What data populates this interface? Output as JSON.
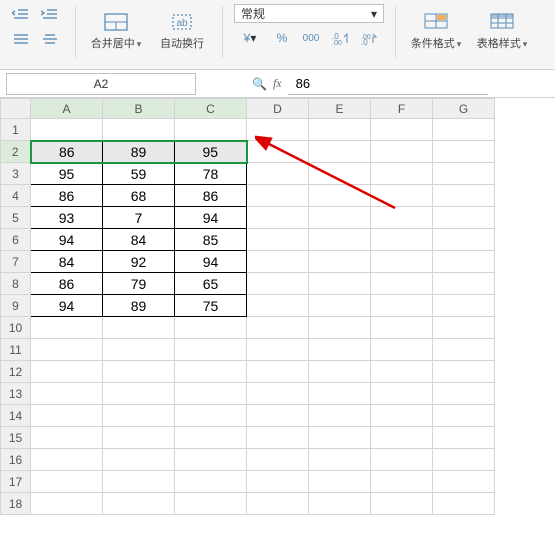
{
  "ribbon": {
    "merge_center": "合并居中",
    "wrap_text": "自动换行",
    "number_format": "常规",
    "conditional_format": "条件格式",
    "table_style": "表格样式"
  },
  "namebox": "A2",
  "formula_value": "86",
  "columns": [
    "A",
    "B",
    "C",
    "D",
    "E",
    "F",
    "G"
  ],
  "row_count": 18,
  "selection": {
    "row": 2,
    "cols": [
      "A",
      "B",
      "C"
    ]
  },
  "chart_data": {
    "type": "table",
    "columns": [
      "A",
      "B",
      "C"
    ],
    "rows": [
      [
        86,
        89,
        95
      ],
      [
        95,
        59,
        78
      ],
      [
        86,
        68,
        86
      ],
      [
        93,
        7,
        94
      ],
      [
        94,
        84,
        85
      ],
      [
        84,
        92,
        94
      ],
      [
        86,
        79,
        65
      ],
      [
        94,
        89,
        75
      ]
    ],
    "first_data_row": 2
  }
}
